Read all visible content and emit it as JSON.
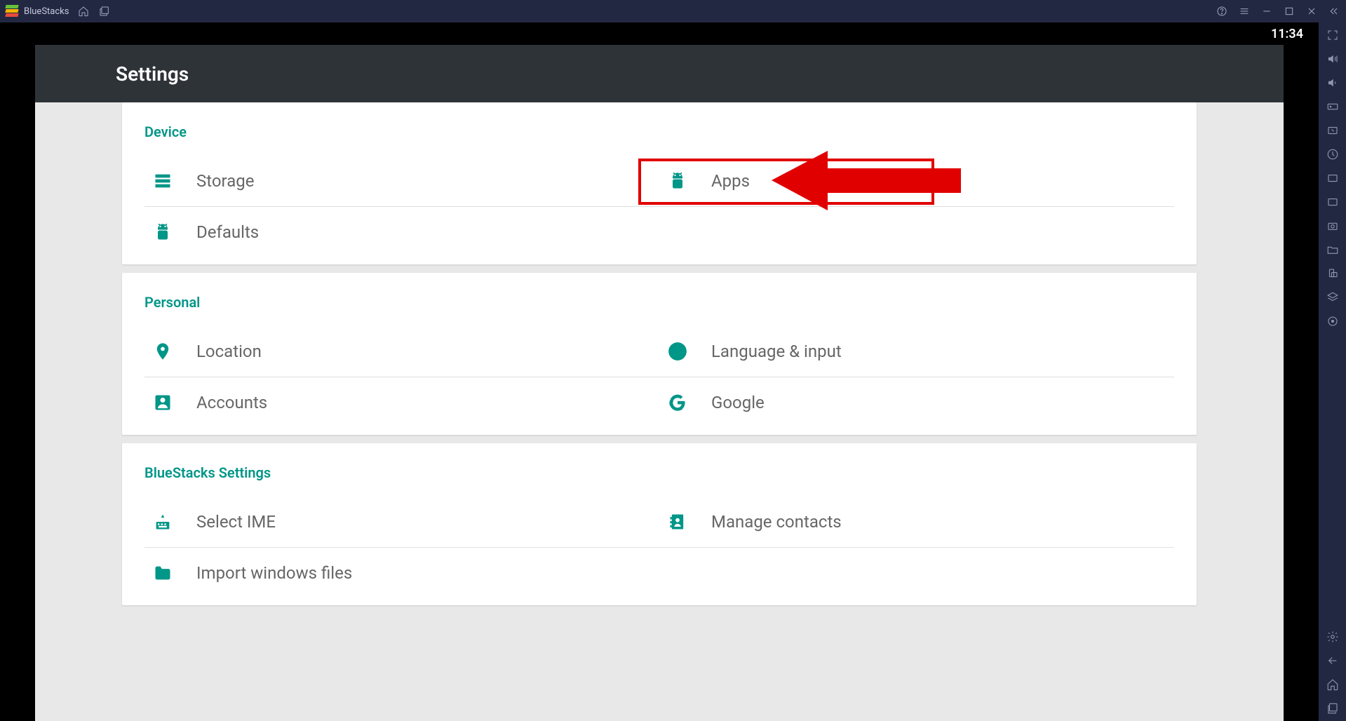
{
  "app": {
    "name": "BlueStacks"
  },
  "status": {
    "time": "11:34"
  },
  "settings": {
    "title": "Settings",
    "sections": {
      "device": {
        "title": "Device",
        "storage": "Storage",
        "apps": "Apps",
        "defaults": "Defaults"
      },
      "personal": {
        "title": "Personal",
        "location": "Location",
        "language": "Language & input",
        "accounts": "Accounts",
        "google": "Google"
      },
      "bluestacks": {
        "title": "BlueStacks Settings",
        "ime": "Select IME",
        "contacts": "Manage contacts",
        "import": "Import windows files"
      }
    }
  }
}
